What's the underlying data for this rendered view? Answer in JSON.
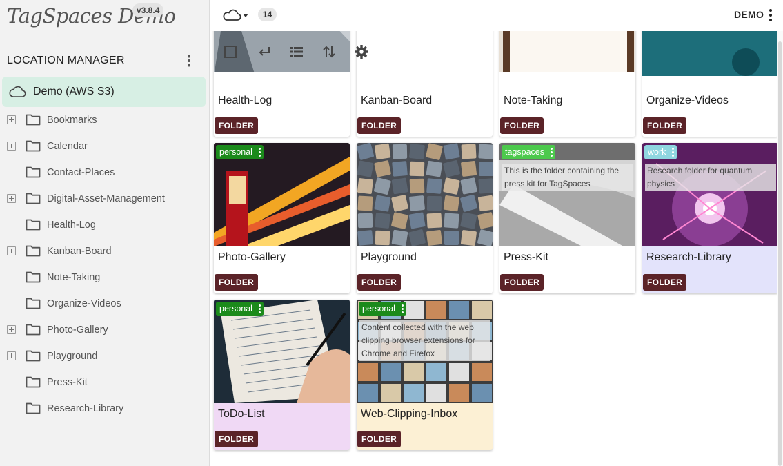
{
  "app": {
    "name": "TagSpaces Demo",
    "version": "v3.8.4"
  },
  "sidebar": {
    "title": "LOCATION MANAGER",
    "location": "Demo (AWS S3)",
    "folders": [
      {
        "label": "Bookmarks",
        "expandable": true
      },
      {
        "label": "Calendar",
        "expandable": true
      },
      {
        "label": "Contact-Places",
        "expandable": false
      },
      {
        "label": "Digital-Asset-Management",
        "expandable": true
      },
      {
        "label": "Health-Log",
        "expandable": false
      },
      {
        "label": "Kanban-Board",
        "expandable": true
      },
      {
        "label": "Note-Taking",
        "expandable": false
      },
      {
        "label": "Organize-Videos",
        "expandable": false
      },
      {
        "label": "Photo-Gallery",
        "expandable": true
      },
      {
        "label": "Playground",
        "expandable": true
      },
      {
        "label": "Press-Kit",
        "expandable": false
      },
      {
        "label": "Research-Library",
        "expandable": false
      }
    ]
  },
  "topbar": {
    "count": "14",
    "user": "DEMO"
  },
  "grid": {
    "type_label": "FOLDER",
    "cards": [
      {
        "title": "Health-Log"
      },
      {
        "title": "Kanban-Board"
      },
      {
        "title": "Note-Taking"
      },
      {
        "title": "Organize-Videos"
      },
      {
        "title": "Photo-Gallery",
        "tag": "personal",
        "tag_color": "#1b8a1b"
      },
      {
        "title": "Playground"
      },
      {
        "title": "Press-Kit",
        "tag": "tagspaces",
        "tag_color": "#4cc94c",
        "description": "This is the folder containing the press kit for TagSpaces"
      },
      {
        "title": "Research-Library",
        "tag": "work",
        "tag_color": "#8fd6e0",
        "description": "Research folder for quantum physics",
        "bg": "#e3e3fb"
      },
      {
        "title": "ToDo-List",
        "tag": "personal",
        "tag_color": "#1b8a1b",
        "bg": "#f0d9f5"
      },
      {
        "title": "Web-Clipping-Inbox",
        "tag": "personal",
        "tag_color": "#1b8a1b",
        "description": "Content collected with the web clipping browser extensions for Chrome and Firefox",
        "bg": "#fcf0d4"
      }
    ]
  },
  "colors": {
    "accent_location": "#d7efe4",
    "folder_chip": "#5b2328"
  }
}
